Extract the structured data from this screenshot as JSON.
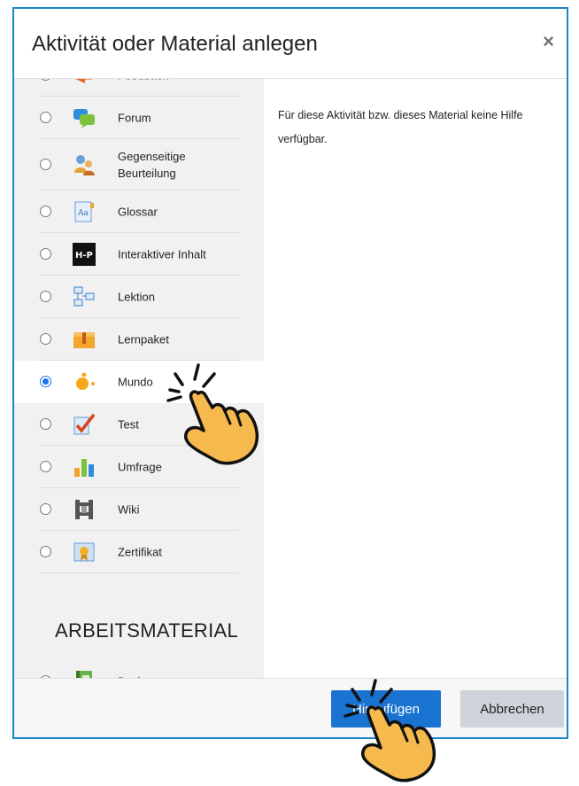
{
  "dialog": {
    "title": "Aktivität oder Material anlegen",
    "close_symbol": "×"
  },
  "help": {
    "text": "Für diese Aktivität bzw. dieses Material keine Hilfe verfügbar."
  },
  "activities": [
    {
      "label": "Feedback",
      "icon": "feedback-icon",
      "selected": false
    },
    {
      "label": "Forum",
      "icon": "forum-icon",
      "selected": false
    },
    {
      "label": "Gegenseitige Beurteilung",
      "icon": "peer-review-icon",
      "selected": false
    },
    {
      "label": "Glossar",
      "icon": "glossary-icon",
      "selected": false
    },
    {
      "label": "Interaktiver Inhalt",
      "icon": "h5p-icon",
      "selected": false
    },
    {
      "label": "Lektion",
      "icon": "lesson-icon",
      "selected": false
    },
    {
      "label": "Lernpaket",
      "icon": "package-icon",
      "selected": false
    },
    {
      "label": "Mundo",
      "icon": "mundo-icon",
      "selected": true
    },
    {
      "label": "Test",
      "icon": "quiz-icon",
      "selected": false
    },
    {
      "label": "Umfrage",
      "icon": "survey-icon",
      "selected": false
    },
    {
      "label": "Wiki",
      "icon": "wiki-icon",
      "selected": false
    },
    {
      "label": "Zertifikat",
      "icon": "certificate-icon",
      "selected": false
    }
  ],
  "resources_section": {
    "title": "ARBEITSMATERIAL",
    "items": [
      {
        "label": "Buch",
        "icon": "book-icon",
        "selected": false
      }
    ]
  },
  "footer": {
    "add_label": "Hinzufügen",
    "cancel_label": "Abbrechen"
  },
  "colors": {
    "primary": "#1a73d0",
    "frame": "#1a86c9",
    "hand": "#f6b94d"
  }
}
